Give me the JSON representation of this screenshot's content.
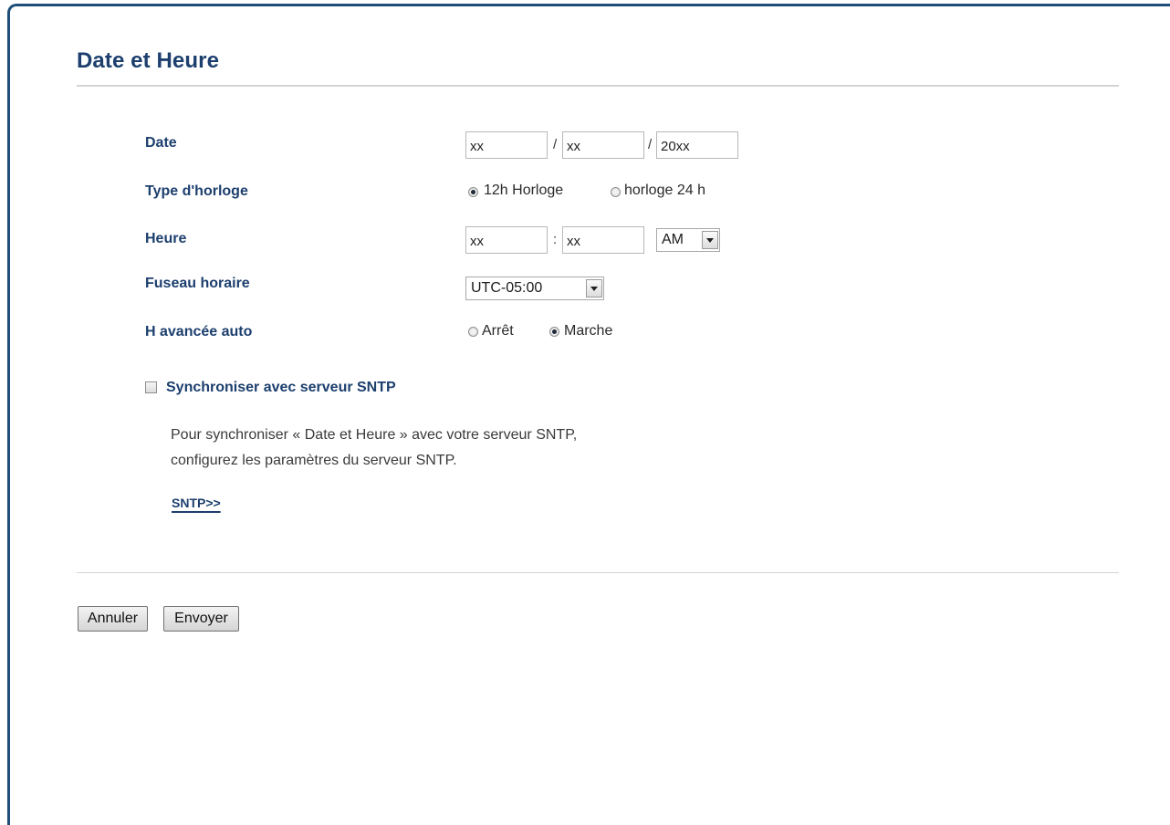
{
  "page": {
    "title": "Date et Heure"
  },
  "form": {
    "date": {
      "label": "Date",
      "month": "xx",
      "sep1": "/",
      "day": "xx",
      "sep2": "/",
      "year": "20xx"
    },
    "clock_type": {
      "label": "Type d'horloge",
      "option_12h": "12h Horloge",
      "option_24h": "horloge 24 h",
      "selected": "12h"
    },
    "time": {
      "label": "Heure",
      "hour": "xx",
      "sep": ":",
      "minute": "xx",
      "ampm": "AM"
    },
    "timezone": {
      "label": "Fuseau horaire",
      "value": "UTC-05:00"
    },
    "dst": {
      "label": "H avancée auto",
      "option_off": "Arrêt",
      "option_on": "Marche",
      "selected": "on"
    },
    "sntp": {
      "checkbox_label": "Synchroniser avec serveur SNTP",
      "checked": false,
      "description_line1": "Pour synchroniser « Date et Heure » avec votre serveur SNTP,",
      "description_line2": "configurez les paramètres du serveur SNTP.",
      "link": "SNTP>>"
    }
  },
  "buttons": {
    "cancel": "Annuler",
    "submit": "Envoyer"
  },
  "colors": {
    "title": "#1c3f6e",
    "frame_border": "#1f4e79",
    "rule": "#d4d4d4"
  }
}
